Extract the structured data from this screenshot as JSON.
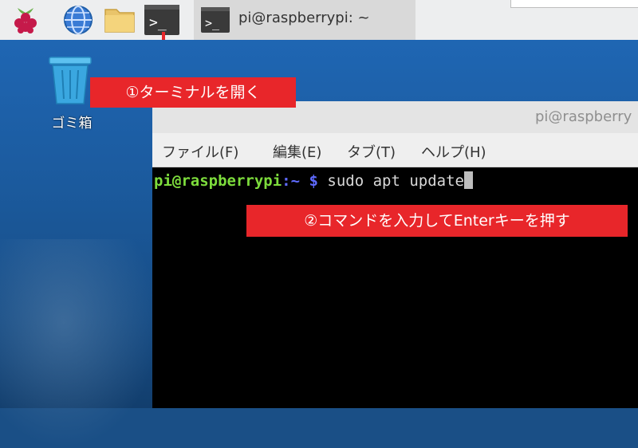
{
  "taskbar": {
    "task_label": "pi@raspberrypi: ~"
  },
  "desktop": {
    "trash_label": "ゴミ箱"
  },
  "terminal": {
    "title": "pi@raspberry",
    "menu": [
      "ファイル(F)",
      "編集(E)",
      "タブ(T)",
      "ヘルプ(H)"
    ],
    "prompt_user": "pi@raspberrypi",
    "prompt_path": ":~",
    "prompt_symbol": " $ ",
    "command": "sudo apt update"
  },
  "annotations": {
    "step1": "①ターミナルを開く",
    "step2": "②コマンドを入力してEnterキーを押す"
  },
  "colors": {
    "annotation": "#e8262a",
    "prompt_user": "#7ddc3c",
    "prompt_path": "#5f6bff"
  },
  "icons": [
    "raspberry-menu-icon",
    "web-browser-icon",
    "file-manager-icon",
    "terminal-icon",
    "trash-icon"
  ]
}
